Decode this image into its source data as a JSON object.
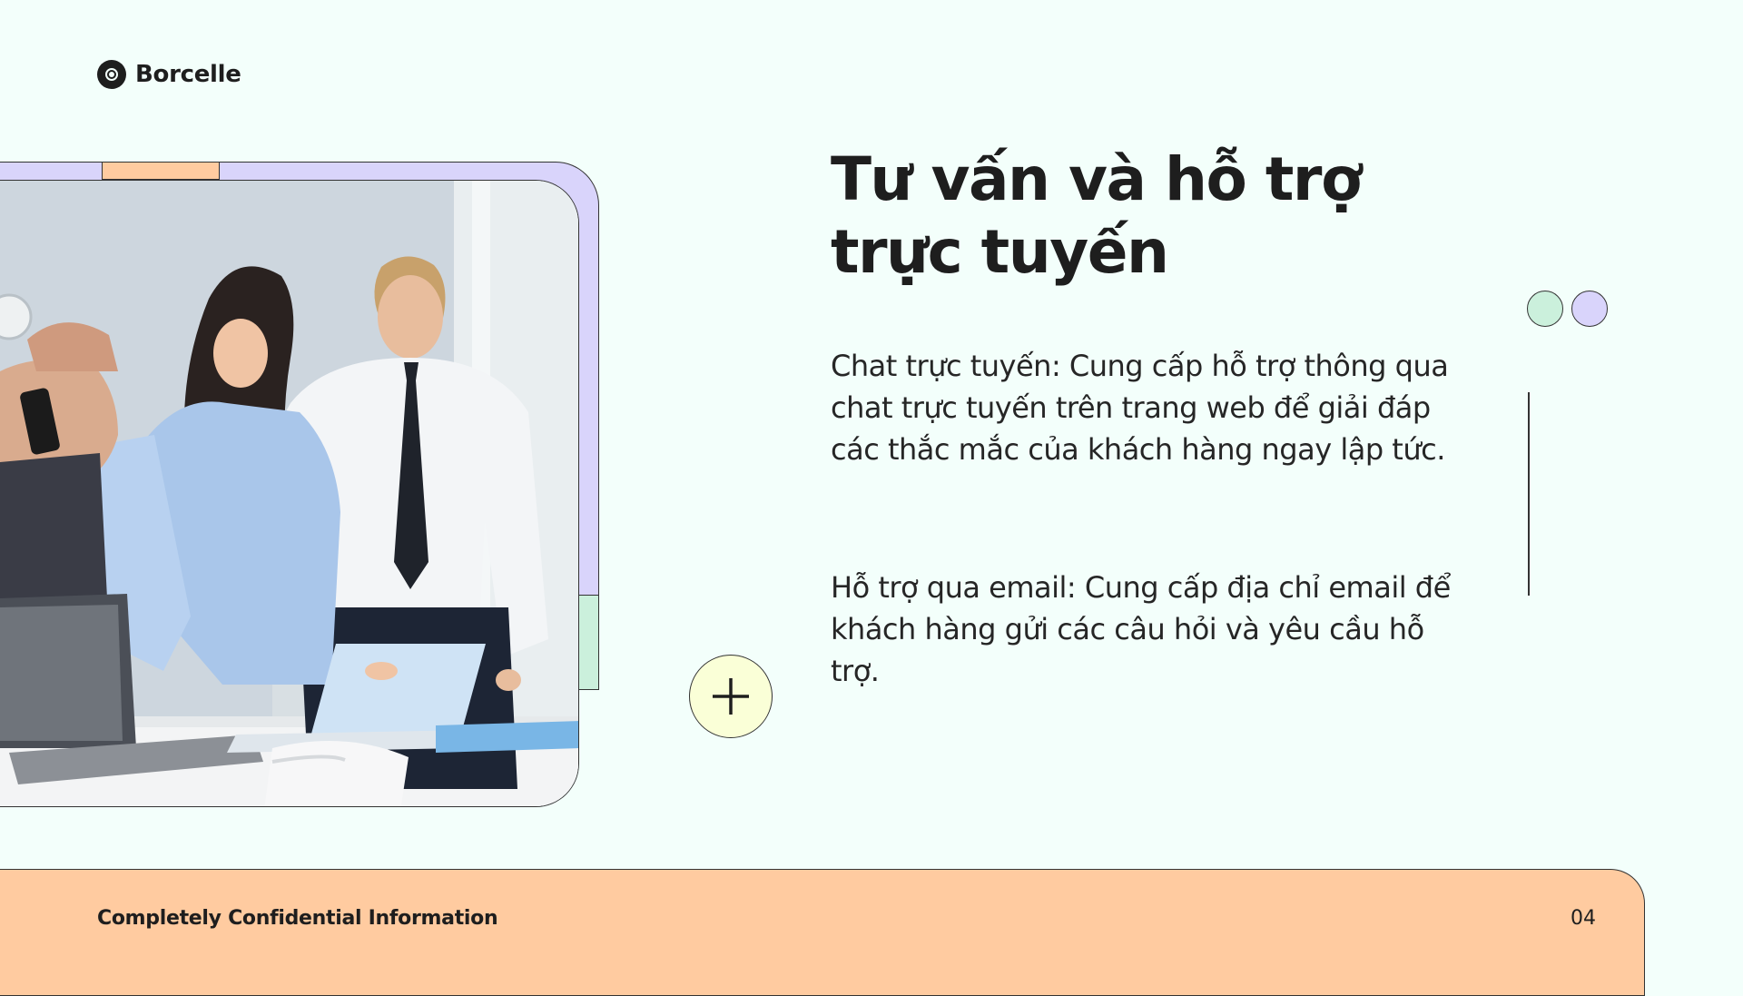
{
  "brand": {
    "name": "Borcelle",
    "icon": "target-logo-icon"
  },
  "slide": {
    "title": "Tư vấn và hỗ trợ trực tuyến",
    "paragraphs": [
      "Chat trực tuyến: Cung cấp hỗ trợ thông qua chat trực tuyến trên trang web để giải đáp các thắc mắc của khách hàng ngay lập tức.",
      "Hỗ trợ qua email: Cung cấp địa chỉ email để khách hàng gửi các câu hỏi và yêu cầu hỗ trợ."
    ],
    "plus_icon": "plus-icon",
    "photo": "office-team-photo"
  },
  "footer": {
    "text": "Completely Confidential Information",
    "page_number": "04"
  },
  "colors": {
    "background": "#F3FFFB",
    "orange": "#FFCBA0",
    "lavender": "#D9D4FB",
    "mint": "#CBF0DC",
    "yellow": "#FAFFD7",
    "text": "#1E1E1E"
  }
}
